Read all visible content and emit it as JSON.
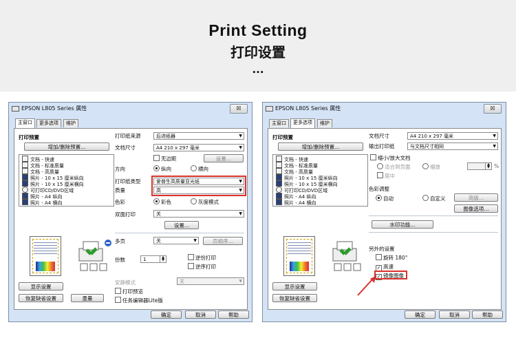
{
  "banner": {
    "title": "Print Setting",
    "subtitle": "打印设置",
    "dots": "..."
  },
  "colors": {
    "highlight": "#d9302a",
    "window_bg": "#d4e3f5",
    "banner_bg": "#efefef"
  },
  "left_window": {
    "title": "EPSON L805 Series 属性",
    "close": "☒",
    "tabs": [
      "主窗口",
      "更多选项",
      "维护"
    ],
    "preset_heading": "打印预置",
    "preset_button": "增加/删除预置...",
    "presets": [
      "文档 - 快速",
      "文档 - 标准质量",
      "文档 - 高质量",
      "照片 - 10 x 15 厘米纵向",
      "照片 - 10 x 15 厘米横向",
      "可打印CD/DVD区域",
      "照片 - A4 纵向",
      "照片 - A4 横向"
    ],
    "show_settings": "显示设置",
    "restore_defaults": "恢复缺省设置",
    "ink_levels": "墨量",
    "paper_source_label": "打印纸来源",
    "paper_source_value": "后进纸器",
    "doc_size_label": "文档尺寸",
    "doc_size_value": "A4 210 x 297 毫米",
    "borderless": "无边距",
    "settings_button": "设置...",
    "orientation_label": "方向",
    "portrait": "纵向",
    "landscape": "横向",
    "paper_type_label": "打印纸类型",
    "paper_type_value": "爱普生高质量亚光纸",
    "quality_label": "质量",
    "quality_value": "高",
    "color_label": "色彩",
    "color_option": "彩色",
    "grayscale_option": "灰度模式",
    "duplex_label": "双面打印",
    "duplex_value": "关",
    "settings_button2": "设置...",
    "multipage_label": "多页",
    "multipage_value": "关",
    "page_order_button": "页顺序...",
    "copies_label": "份数",
    "copies_value": "1",
    "collate": "逆份打印",
    "reverse_order": "逆序打印",
    "quiet_label": "安静模式",
    "quiet_value": "关",
    "print_preview": "打印预览",
    "job_arranger": "任务编辑器Lite版",
    "ok": "确定",
    "cancel": "取消",
    "help": "帮助"
  },
  "right_window": {
    "title": "EPSON L805 Series 属性",
    "close": "☒",
    "tabs": [
      "主窗口",
      "更多选项",
      "维护"
    ],
    "preset_heading": "打印预置",
    "preset_button": "增加/删除预置...",
    "presets": [
      "文档 - 快速",
      "文档 - 标准质量",
      "文档 - 高质量",
      "照片 - 10 x 15 厘米纵向",
      "照片 - 10 x 15 厘米横向",
      "可打印CD/DVD区域",
      "照片 - A4 纵向",
      "照片 - A4 横向"
    ],
    "show_settings": "显示设置",
    "restore_defaults": "恢复缺省设置",
    "doc_size_label": "文档尺寸",
    "doc_size_value": "A4 210 x 297 毫米",
    "output_paper_label": "输出打印纸",
    "output_paper_value": "与文档尺寸相同",
    "reduce_enlarge": "缩小/放大文档",
    "fit_to_page": "适合到页面",
    "zoom": "缩放",
    "zoom_unit": "%",
    "center": "居中",
    "color_correction_label": "色彩调整",
    "auto": "自动",
    "custom": "自定义",
    "advanced_button": "高级...",
    "image_options_button": "图像选项...",
    "watermark_button": "水印功能...",
    "extra_settings_label": "另外的设置",
    "rotate_180": "旋转 180°",
    "high_speed": "高速",
    "mirror_image": "镜像图像",
    "ok": "确定",
    "cancel": "取消",
    "help": "帮助"
  }
}
